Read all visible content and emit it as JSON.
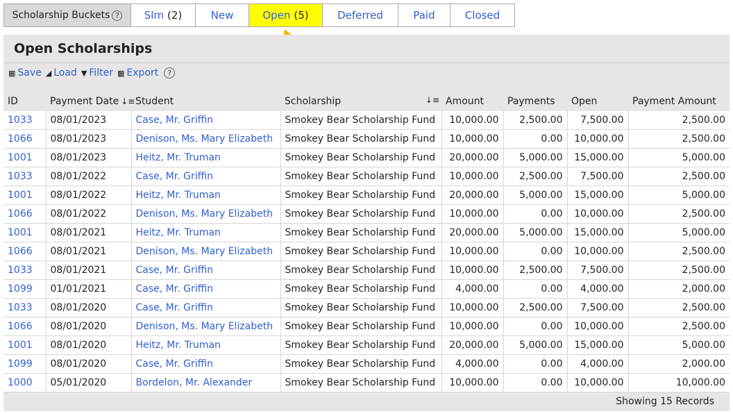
{
  "buckets": {
    "title": "Scholarship Buckets",
    "help": "?",
    "tabs": [
      {
        "label": "Slm",
        "count": "(2)",
        "active": false
      },
      {
        "label": "New",
        "count": "",
        "active": false
      },
      {
        "label": "Open",
        "count": "(5)",
        "active": true
      },
      {
        "label": "Deferred",
        "count": "",
        "active": false
      },
      {
        "label": "Paid",
        "count": "",
        "active": false
      },
      {
        "label": "Closed",
        "count": "",
        "active": false
      }
    ]
  },
  "panel": {
    "title": "Open Scholarships",
    "toolbar": {
      "save": "Save",
      "load": "Load",
      "filter": "Filter",
      "export": "Export",
      "help": "?"
    }
  },
  "table": {
    "columns": [
      "ID",
      "Payment Date",
      "Student",
      "Scholarship",
      "Amount",
      "Payments",
      "Open",
      "Payment Amount"
    ],
    "rows": [
      [
        "1033",
        "08/01/2023",
        "Case, Mr. Griffin",
        "Smokey Bear Scholarship Fund",
        "10,000.00",
        "2,500.00",
        "7,500.00",
        "2,500.00"
      ],
      [
        "1066",
        "08/01/2023",
        "Denison, Ms. Mary Elizabeth",
        "Smokey Bear Scholarship Fund",
        "10,000.00",
        "0.00",
        "10,000.00",
        "2,500.00"
      ],
      [
        "1001",
        "08/01/2023",
        "Heitz, Mr. Truman",
        "Smokey Bear Scholarship Fund",
        "20,000.00",
        "5,000.00",
        "15,000.00",
        "5,000.00"
      ],
      [
        "1033",
        "08/01/2022",
        "Case, Mr. Griffin",
        "Smokey Bear Scholarship Fund",
        "10,000.00",
        "2,500.00",
        "7,500.00",
        "2,500.00"
      ],
      [
        "1001",
        "08/01/2022",
        "Heitz, Mr. Truman",
        "Smokey Bear Scholarship Fund",
        "20,000.00",
        "5,000.00",
        "15,000.00",
        "5,000.00"
      ],
      [
        "1066",
        "08/01/2022",
        "Denison, Ms. Mary Elizabeth",
        "Smokey Bear Scholarship Fund",
        "10,000.00",
        "0.00",
        "10,000.00",
        "2,500.00"
      ],
      [
        "1001",
        "08/01/2021",
        "Heitz, Mr. Truman",
        "Smokey Bear Scholarship Fund",
        "20,000.00",
        "5,000.00",
        "15,000.00",
        "5,000.00"
      ],
      [
        "1066",
        "08/01/2021",
        "Denison, Ms. Mary Elizabeth",
        "Smokey Bear Scholarship Fund",
        "10,000.00",
        "0.00",
        "10,000.00",
        "2,500.00"
      ],
      [
        "1033",
        "08/01/2021",
        "Case, Mr. Griffin",
        "Smokey Bear Scholarship Fund",
        "10,000.00",
        "2,500.00",
        "7,500.00",
        "2,500.00"
      ],
      [
        "1099",
        "01/01/2021",
        "Case, Mr. Griffin",
        "Smokey Bear Scholarship Fund",
        "4,000.00",
        "0.00",
        "4,000.00",
        "2,000.00"
      ],
      [
        "1033",
        "08/01/2020",
        "Case, Mr. Griffin",
        "Smokey Bear Scholarship Fund",
        "10,000.00",
        "2,500.00",
        "7,500.00",
        "2,500.00"
      ],
      [
        "1066",
        "08/01/2020",
        "Denison, Ms. Mary Elizabeth",
        "Smokey Bear Scholarship Fund",
        "10,000.00",
        "0.00",
        "10,000.00",
        "2,500.00"
      ],
      [
        "1001",
        "08/01/2020",
        "Heitz, Mr. Truman",
        "Smokey Bear Scholarship Fund",
        "20,000.00",
        "5,000.00",
        "15,000.00",
        "5,000.00"
      ],
      [
        "1099",
        "08/01/2020",
        "Case, Mr. Griffin",
        "Smokey Bear Scholarship Fund",
        "4,000.00",
        "0.00",
        "4,000.00",
        "2,000.00"
      ],
      [
        "1000",
        "05/01/2020",
        "Bordelon, Mr. Alexander",
        "Smokey Bear Scholarship Fund",
        "10,000.00",
        "0.00",
        "10,000.00",
        "10,000.00"
      ]
    ],
    "footer": "Showing 15 Records"
  },
  "colors": {
    "link": "#2f5fcf",
    "active_tab": "#ffff00",
    "arrow": "#f5b400",
    "panel_bg": "#e6e6e6"
  },
  "icons": {
    "save": "floppy-disk-icon",
    "load": "folder-open-icon",
    "filter": "funnel-icon",
    "export": "export-icon",
    "sort": "sort-icon",
    "annotation": "arrow-icon"
  }
}
